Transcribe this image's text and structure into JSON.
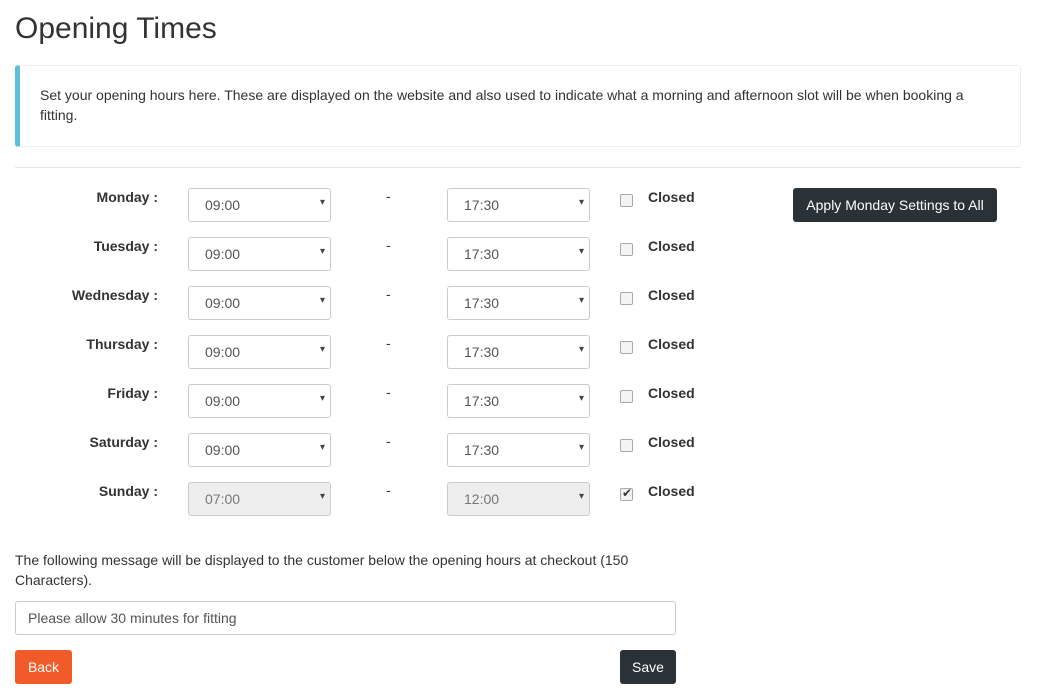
{
  "page": {
    "title": "Opening Times",
    "info": "Set your opening hours here. These are displayed on the website and also used to indicate what a morning and afternoon slot will be when booking a fitting."
  },
  "schedule": {
    "separator": "-",
    "closed_label": "Closed",
    "caret": "▾",
    "tick": "✔",
    "days": [
      {
        "label": "Monday :",
        "open": "09:00",
        "close": "17:30",
        "closed": false
      },
      {
        "label": "Tuesday :",
        "open": "09:00",
        "close": "17:30",
        "closed": false
      },
      {
        "label": "Wednesday :",
        "open": "09:00",
        "close": "17:30",
        "closed": false
      },
      {
        "label": "Thursday :",
        "open": "09:00",
        "close": "17:30",
        "closed": false
      },
      {
        "label": "Friday :",
        "open": "09:00",
        "close": "17:30",
        "closed": false
      },
      {
        "label": "Saturday :",
        "open": "09:00",
        "close": "17:30",
        "closed": false
      },
      {
        "label": "Sunday :",
        "open": "07:00",
        "close": "12:00",
        "closed": true
      }
    ]
  },
  "apply_button": "Apply Monday Settings to All",
  "message": {
    "label": "The following message will be displayed to the customer below the opening hours at checkout (150 Characters).",
    "value": "Please allow 30 minutes for fitting"
  },
  "buttons": {
    "back": "Back",
    "save": "Save"
  },
  "colors": {
    "info_accent": "#5bc0de",
    "dark_button": "#2a3238",
    "back_button": "#f15a29"
  }
}
